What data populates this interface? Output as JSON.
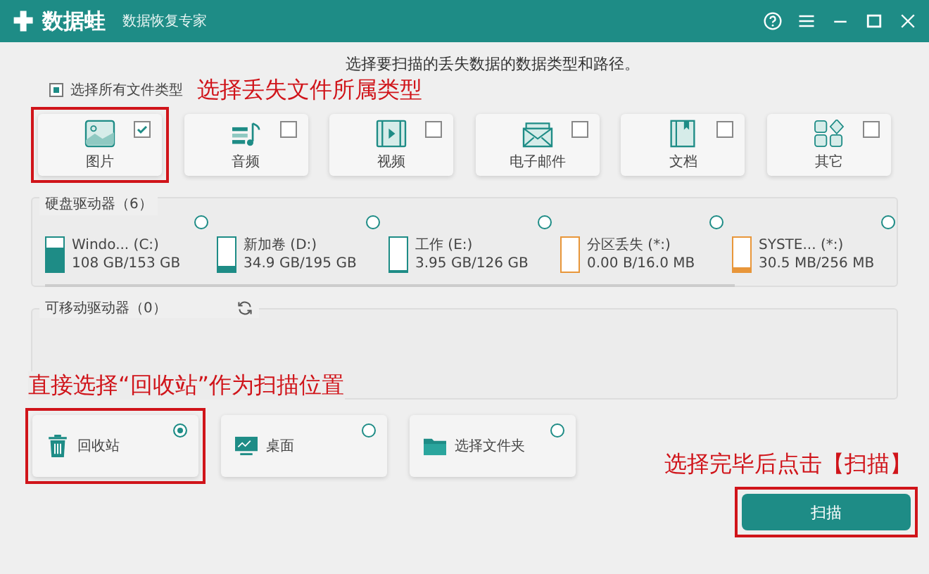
{
  "app": {
    "name": "数据蛙",
    "subtitle": "数据恢复专家",
    "controls": [
      {
        "kind": "help"
      },
      {
        "kind": "menu"
      },
      {
        "kind": "minimize"
      },
      {
        "kind": "maximize"
      },
      {
        "kind": "close"
      }
    ]
  },
  "instruction": "选择要扫描的丢失数据的数据类型和路径。",
  "select_all": {
    "label": "选择所有文件类型",
    "checked": true
  },
  "file_types": [
    {
      "kind": "image",
      "label": "图片",
      "checked": true,
      "highlighted": true
    },
    {
      "kind": "audio",
      "label": "音频",
      "checked": false,
      "highlighted": false
    },
    {
      "kind": "video",
      "label": "视频",
      "checked": false,
      "highlighted": false
    },
    {
      "kind": "email",
      "label": "电子邮件",
      "checked": false,
      "highlighted": false
    },
    {
      "kind": "document",
      "label": "文档",
      "checked": false,
      "highlighted": false
    },
    {
      "kind": "other",
      "label": "其它",
      "checked": false,
      "highlighted": false
    }
  ],
  "hard_drives": {
    "title": "硬盘驱动器（6）",
    "drives": [
      {
        "name": "Windo... (C:)",
        "usage": "108 GB/153 GB",
        "level": 0.7,
        "color": "#1e8c86",
        "selected": false
      },
      {
        "name": "新加卷 (D:)",
        "usage": "34.9 GB/195 GB",
        "level": 0.18,
        "color": "#1e8c86",
        "selected": false
      },
      {
        "name": "工作 (E:)",
        "usage": "3.95 GB/126 GB",
        "level": 0.03,
        "color": "#1e8c86",
        "selected": false
      },
      {
        "name": "分区丢失 (*:)",
        "usage": "0.00  B/16.0 MB",
        "level": 0,
        "color": "#e8963a",
        "selected": false
      },
      {
        "name": "SYSTE... (*:)",
        "usage": "30.5 MB/256 MB",
        "level": 0.12,
        "color": "#e8963a",
        "selected": false
      }
    ]
  },
  "removable_drives": {
    "title": "可移动驱动器（0）"
  },
  "locations": [
    {
      "kind": "recycle",
      "label": "回收站",
      "selected": true,
      "highlighted": true
    },
    {
      "kind": "desktop",
      "label": "桌面",
      "selected": false,
      "highlighted": false
    },
    {
      "kind": "folder",
      "label": "选择文件夹",
      "selected": false,
      "highlighted": false
    }
  ],
  "annotations": [
    "选择丢失文件所属类型",
    "直接选择“回收站”作为扫描位置",
    "选择完毕后点击【扫描】"
  ],
  "scan_button": {
    "label": "扫描",
    "highlighted": true
  }
}
